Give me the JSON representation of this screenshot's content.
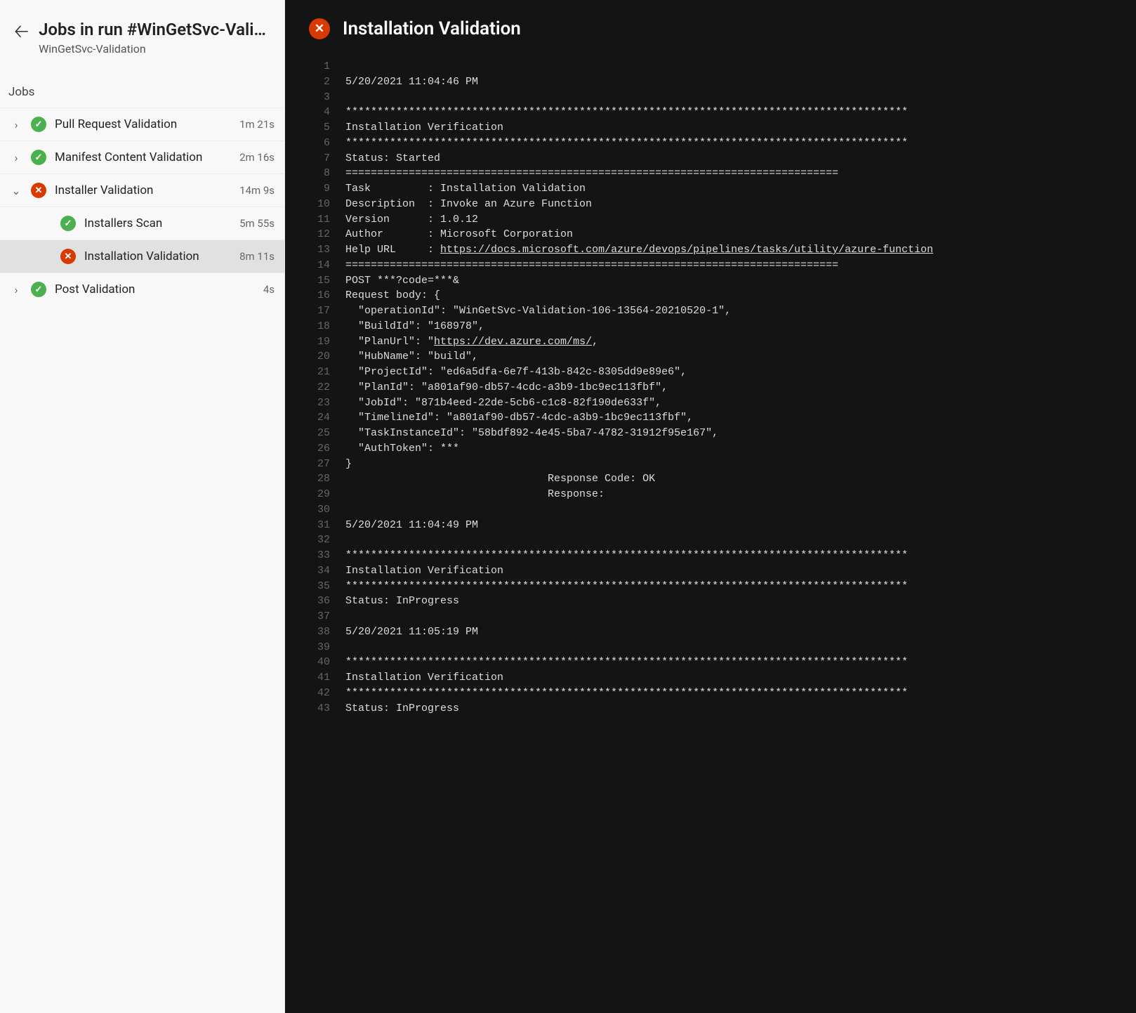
{
  "header": {
    "title": "Jobs in run #WinGetSvc-Valida…",
    "subtitle": "WinGetSvc-Validation",
    "jobs_label": "Jobs"
  },
  "jobs": [
    {
      "name": "Pull Request Validation",
      "status": "success",
      "expanded": false,
      "duration": "1m 21s"
    },
    {
      "name": "Manifest Content Validation",
      "status": "success",
      "expanded": false,
      "duration": "2m 16s"
    },
    {
      "name": "Installer Validation",
      "status": "fail",
      "expanded": true,
      "duration": "14m 9s",
      "steps": [
        {
          "name": "Installers Scan",
          "status": "success",
          "duration": "5m 55s",
          "selected": false
        },
        {
          "name": "Installation Validation",
          "status": "fail",
          "duration": "8m 11s",
          "selected": true
        }
      ]
    },
    {
      "name": "Post Validation",
      "status": "success",
      "expanded": false,
      "duration": "4s"
    }
  ],
  "detail": {
    "title": "Installation Validation",
    "status": "fail",
    "help_url": "https://docs.microsoft.com/azure/devops/pipelines/tasks/utility/azure-function",
    "plan_url": "https://dev.azure.com/ms/",
    "log": [
      "",
      "5/20/2021 11:04:46 PM",
      "",
      "*****************************************************************************************",
      "Installation Verification",
      "*****************************************************************************************",
      "Status: Started",
      "==============================================================================",
      "Task         : Installation Validation",
      "Description  : Invoke an Azure Function",
      "Version      : 1.0.12",
      "Author       : Microsoft Corporation",
      {
        "text": "Help URL     : ",
        "link": "help_url"
      },
      "==============================================================================",
      "POST ***?code=***&",
      "Request body: {",
      "  \"operationId\": \"WinGetSvc-Validation-106-13564-20210520-1\",",
      "  \"BuildId\": \"168978\",",
      {
        "text": "  \"PlanUrl\": \"",
        "link": "plan_url",
        "suffix": ","
      },
      "  \"HubName\": \"build\",",
      "  \"ProjectId\": \"ed6a5dfa-6e7f-413b-842c-8305dd9e89e6\",",
      "  \"PlanId\": \"a801af90-db57-4cdc-a3b9-1bc9ec113fbf\",",
      "  \"JobId\": \"871b4eed-22de-5cb6-c1c8-82f190de633f\",",
      "  \"TimelineId\": \"a801af90-db57-4cdc-a3b9-1bc9ec113fbf\",",
      "  \"TaskInstanceId\": \"58bdf892-4e45-5ba7-4782-31912f95e167\",",
      "  \"AuthToken\": ***",
      "}",
      "                                Response Code: OK",
      "                                Response:",
      "",
      "5/20/2021 11:04:49 PM",
      "",
      "*****************************************************************************************",
      "Installation Verification",
      "*****************************************************************************************",
      "Status: InProgress",
      "",
      "5/20/2021 11:05:19 PM",
      "",
      "*****************************************************************************************",
      "Installation Verification",
      "*****************************************************************************************",
      "Status: InProgress"
    ]
  },
  "icons": {
    "check": "✓",
    "cross": "✕"
  }
}
